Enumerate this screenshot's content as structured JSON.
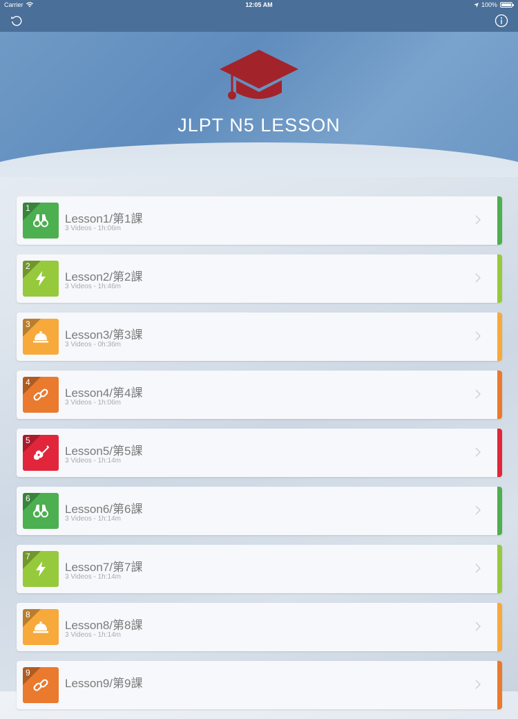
{
  "status": {
    "carrier": "Carrier",
    "time": "12:05 AM",
    "battery": "100%"
  },
  "header": {
    "title": "JLPT N5 LESSON"
  },
  "colors": {
    "green": "#4caf50",
    "lime": "#97c93d",
    "orange": "#f7a93c",
    "deeporange": "#ea7a2e",
    "red": "#e1263b"
  },
  "lessons": [
    {
      "num": "1",
      "name": "Lesson1/第1課",
      "meta": "3 Videos - 1h:06m",
      "color": "#4caf50",
      "icon": "binoculars-icon"
    },
    {
      "num": "2",
      "name": "Lesson2/第2課",
      "meta": "3 Videos - 1h:46m",
      "color": "#97c93d",
      "icon": "lightning-icon"
    },
    {
      "num": "3",
      "name": "Lesson3/第3課",
      "meta": "3 Videos - 0h:36m",
      "color": "#f7a93c",
      "icon": "service-bell-icon"
    },
    {
      "num": "4",
      "name": "Lesson4/第4課",
      "meta": "3 Videos - 1h:06m",
      "color": "#ea7a2e",
      "icon": "link-icon"
    },
    {
      "num": "5",
      "name": "Lesson5/第5課",
      "meta": "3 Videos - 1h:14m",
      "color": "#e1263b",
      "icon": "guitar-icon"
    },
    {
      "num": "6",
      "name": "Lesson6/第6課",
      "meta": "3 Videos - 1h:14m",
      "color": "#4caf50",
      "icon": "binoculars-icon"
    },
    {
      "num": "7",
      "name": "Lesson7/第7課",
      "meta": "3 Videos - 1h:14m",
      "color": "#97c93d",
      "icon": "lightning-icon"
    },
    {
      "num": "8",
      "name": "Lesson8/第8課",
      "meta": "3 Videos - 1h:14m",
      "color": "#f7a93c",
      "icon": "service-bell-icon"
    },
    {
      "num": "9",
      "name": "Lesson9/第9課",
      "meta": "",
      "color": "#ea7a2e",
      "icon": "link-icon"
    }
  ]
}
